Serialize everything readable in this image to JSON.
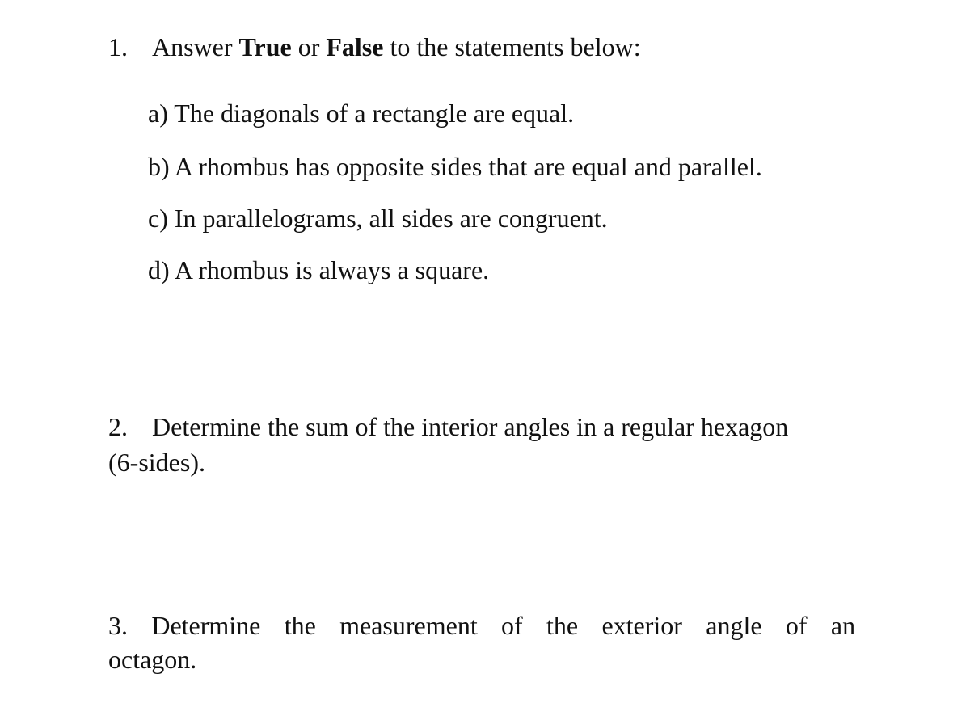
{
  "questions": [
    {
      "number": "1.",
      "prefix": "Answer ",
      "bold1": "True",
      "middle": " or ",
      "bold2": "False",
      "suffix": " to the statements below:",
      "statements": [
        "a) The diagonals of a rectangle are equal.",
        "b) A rhombus has opposite sides that are equal and parallel.",
        "c) In parallelograms, all sides are congruent.",
        "d) A rhombus is always a square."
      ]
    },
    {
      "number": "2.",
      "line1": "Determine the sum of the interior angles in a regular hexagon",
      "line2": "(6-sides)."
    },
    {
      "number": "3.",
      "words": [
        "3.",
        "Determine",
        "the",
        "measurement",
        "of",
        "the",
        "exterior",
        "angle",
        "of",
        "an"
      ],
      "line2": "octagon."
    }
  ]
}
